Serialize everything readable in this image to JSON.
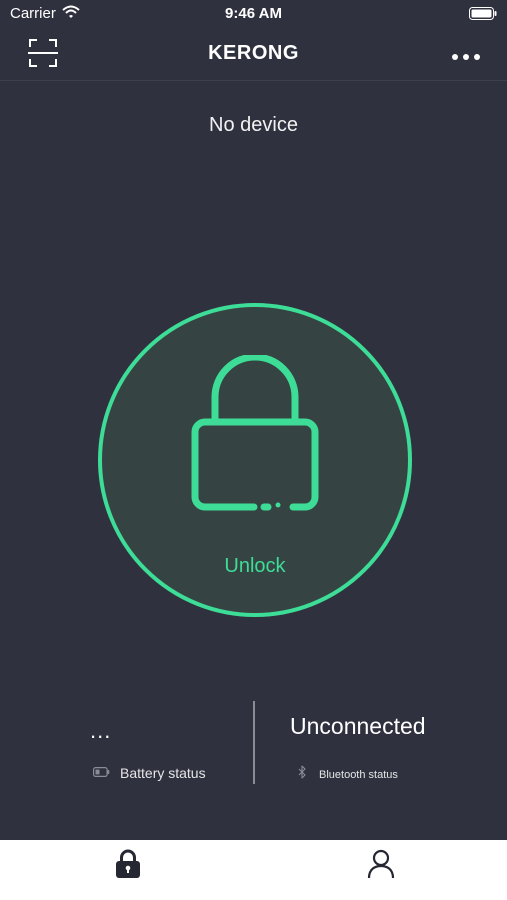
{
  "status_bar": {
    "carrier": "Carrier",
    "time": "9:46 AM"
  },
  "header": {
    "title": "KERONG",
    "scan_icon": "scan-icon",
    "more_icon": "more-dots-icon"
  },
  "device": {
    "label": "No device"
  },
  "lock": {
    "icon": "padlock-icon",
    "label": "Unlock",
    "accent_color": "#3ddc97"
  },
  "battery": {
    "value": "...",
    "label": "Battery status",
    "icon": "battery-icon"
  },
  "bluetooth": {
    "value": "Unconnected",
    "label": "Bluetooth status",
    "icon": "bluetooth-icon"
  },
  "tab_bar": {
    "items": [
      {
        "icon": "lock-tab-icon"
      },
      {
        "icon": "person-icon"
      }
    ]
  },
  "colors": {
    "background": "#2f313f",
    "accent": "#3ddc97",
    "tab_bar": "#ffffff"
  }
}
